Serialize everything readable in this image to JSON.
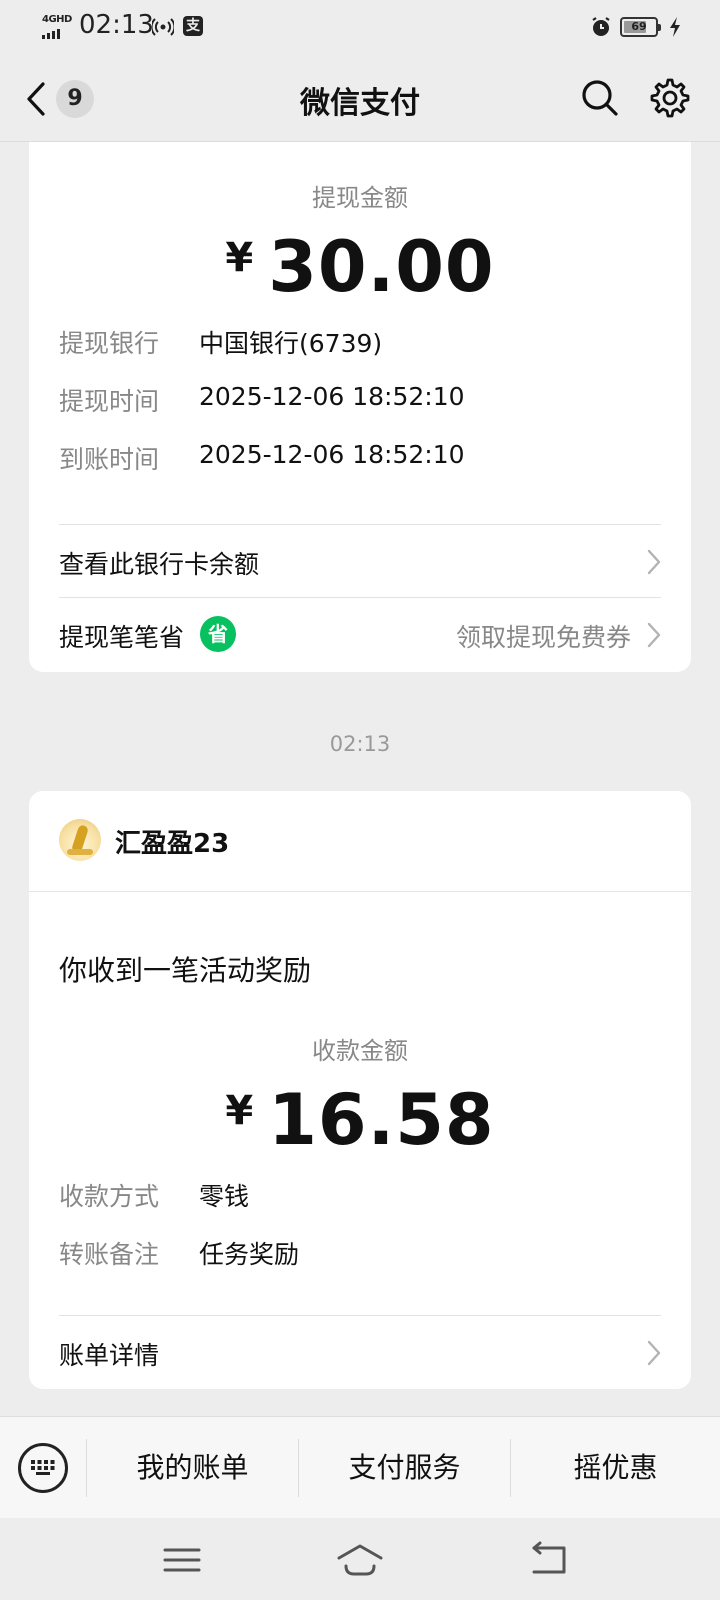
{
  "status_bar": {
    "network": "4GHD",
    "time": "02:13",
    "battery": "69"
  },
  "nav": {
    "back_badge": "9",
    "title": "微信支付"
  },
  "withdraw_card": {
    "amount_label": "提现金额",
    "currency": "¥",
    "amount": "30.00",
    "rows": [
      {
        "key": "提现银行",
        "value": "中国银行(6739)"
      },
      {
        "key": "提现时间",
        "value": "2025-12-06 18:52:10"
      },
      {
        "key": "到账时间",
        "value": "2025-12-06 18:52:10"
      }
    ],
    "balance_link": "查看此银行卡余额",
    "savings_label": "提现笔笔省",
    "savings_badge": "省",
    "coupon_link": "领取提现免费券"
  },
  "timestamp": "02:13",
  "reward_card": {
    "sender_name": "汇盈盈23",
    "message": "你收到一笔活动奖励",
    "amount_label": "收款金额",
    "currency": "¥",
    "amount": "16.58",
    "rows": [
      {
        "key": "收款方式",
        "value": "零钱"
      },
      {
        "key": "转账备注",
        "value": "任务奖励"
      }
    ],
    "detail_link": "账单详情"
  },
  "bottom_menu": {
    "items": [
      "我的账单",
      "支付服务",
      "摇优惠"
    ]
  },
  "colors": {
    "wechat_green": "#07c160",
    "background": "#ededed",
    "card": "#ffffff",
    "secondary_text": "#888888"
  }
}
